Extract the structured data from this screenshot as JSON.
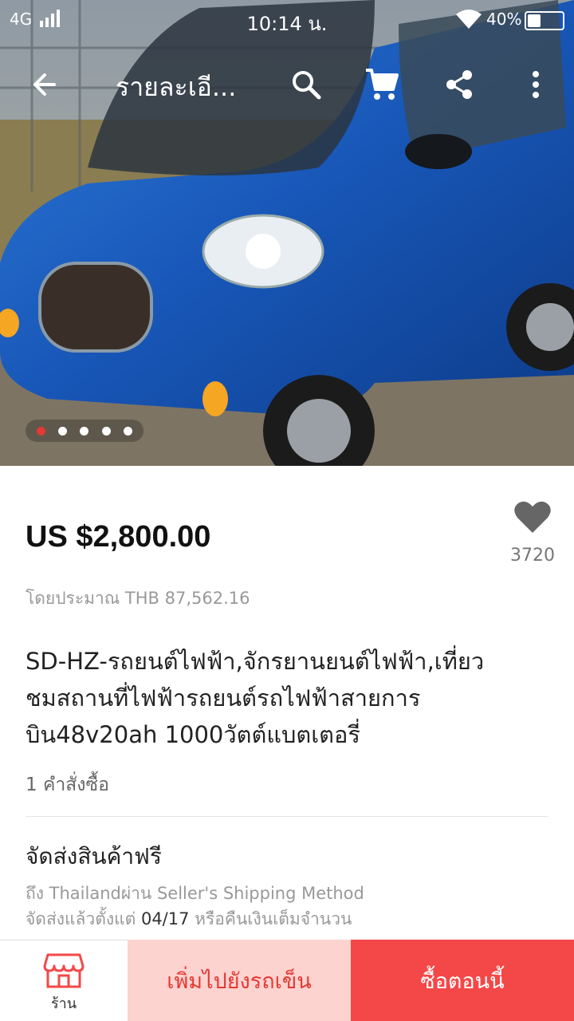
{
  "status_bar": {
    "network": "4G",
    "time": "10:14 น.",
    "battery": "40%"
  },
  "header": {
    "title": "รายละเอี..."
  },
  "gallery": {
    "image_count": 5,
    "active_index": 0
  },
  "product": {
    "price": "US $2,800.00",
    "approx_price": "โดยประมาณ THB 87,562.16",
    "favorites_count": "3720",
    "title_lines": [
      "SD-HZ-รถยนต์ไฟฟ้า,จักรยานยนต์ไฟฟ้า,เที่ยว",
      "ชมสถานที่ไฟฟ้ารถยนต์รถไฟฟ้าสายการ",
      "บิน48v20ah 1000วัตต์แบตเตอรี่"
    ],
    "orders": "1 คำสั่งซื้อ"
  },
  "shipping": {
    "title": "จัดส่งสินค้าฟรี",
    "line1": "ถึง Thailandผ่าน Seller's Shipping Method",
    "line2_prefix": "จัดส่งแล้วตั้งแต่ ",
    "line2_date": "04/17",
    "line2_suffix": " หรือคืนเงินเต็มจำนวน"
  },
  "bottom_bar": {
    "store_label": "ร้าน",
    "add_to_cart_label": "เพิ่มไปยังรถเข็น",
    "buy_now_label": "ซื้อตอนนี้"
  },
  "colors": {
    "accent_red": "#f44747",
    "cart_bg": "#fdd3d0",
    "cart_text": "#e53935"
  }
}
